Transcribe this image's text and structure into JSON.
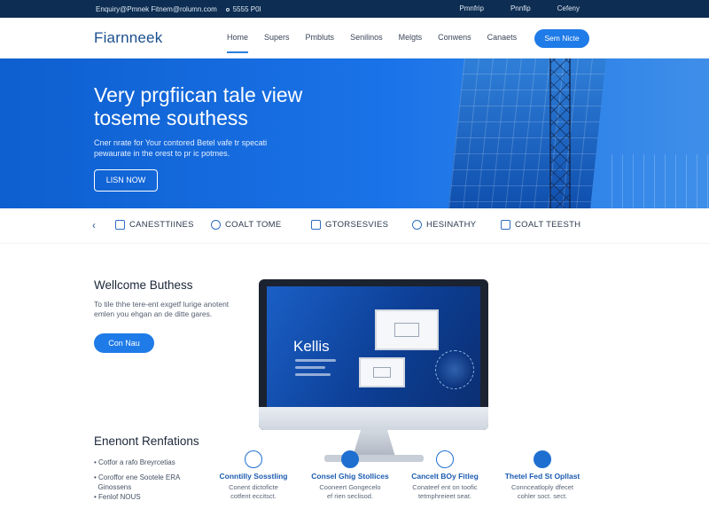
{
  "topbar": {
    "left_text": "Enquiry@Pmnek Fitnem@rolumn.com",
    "left_text2": "5555 P0I",
    "right_links": [
      "Pmnfrip",
      "Pnnfip",
      "Cefeny"
    ]
  },
  "navbar": {
    "logo": "Fiarnneek",
    "items": [
      "Home",
      "Supers",
      "Pmbluts",
      "Senilinos",
      "Melgts",
      "Conwens",
      "Canaets"
    ],
    "active_index": 0,
    "cta": "Sem Nicte"
  },
  "hero": {
    "title_line1": "Very prgfiican tale view",
    "title_line2": "toseme southess",
    "subtitle_line1": "Cner nrate for Your contored Betel vafe tr specati",
    "subtitle_line2": "pewaurate in the orest to pr ic potmes.",
    "cta": "LISN NOW"
  },
  "strip": {
    "features": [
      {
        "icon": "document-icon",
        "label": "CANESTTIINES"
      },
      {
        "icon": "phone-icon",
        "label": "COALT TOME"
      },
      {
        "icon": "clipboard-icon",
        "label": "GTORSESVIES"
      },
      {
        "icon": "link-icon",
        "label": "HESINATHY"
      },
      {
        "icon": "shield-icon",
        "label": "COALT TEESTH"
      }
    ]
  },
  "welcome": {
    "title": "Wellcome Buthess",
    "text_line1": "To tile thhe tere-ent exgetf lurige anotent",
    "text_line2": "emlen you ehgan an de ditte gares.",
    "button": "Con Nau"
  },
  "monitor": {
    "screen_title": "Kellis"
  },
  "solutions": {
    "title": "Enenont Renfations",
    "list": [
      "Cotfor a rafo Breyrcetias",
      "Coroffor ene Sootele ERA",
      "Ginossens",
      "Fenlof NOUS"
    ],
    "cards": [
      {
        "icon": "globe-icon",
        "title": "Conntilly Sosstling",
        "desc_line1": "Conent dictoficte",
        "desc_line2": "cotfent eccitsct."
      },
      {
        "icon": "target-icon",
        "title": "Consel Ghig Stollices",
        "desc_line1": "Cooneert Gongecelo",
        "desc_line2": "ef rien seclisod."
      },
      {
        "icon": "location-icon",
        "title": "Cancelt BOy Fitleg",
        "desc_line1": "Conateef ent on toofic",
        "desc_line2": "tetmphreieet seat."
      },
      {
        "icon": "pin-icon",
        "title": "Thetel Fed St Opllast",
        "desc_line1": "Connceatloply dfecet",
        "desc_line2": "cohler soct. sect."
      }
    ]
  }
}
